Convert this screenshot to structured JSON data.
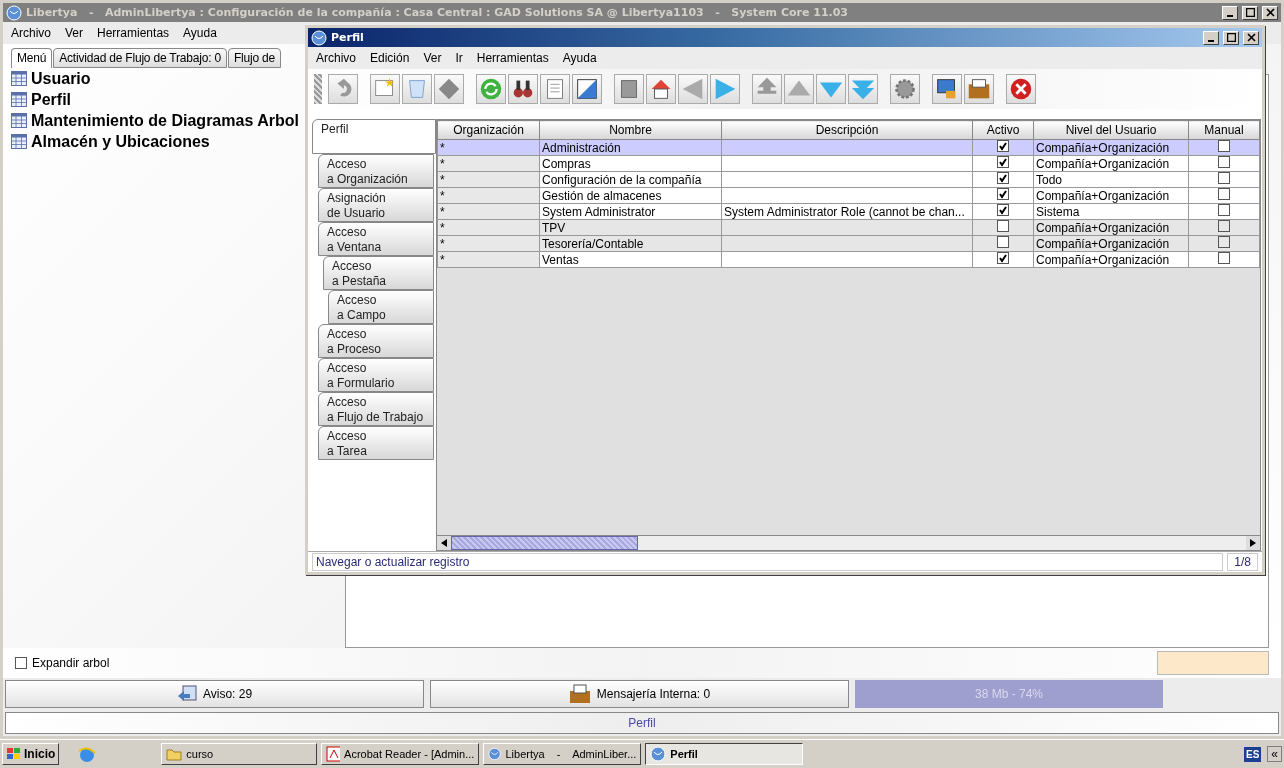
{
  "main_window": {
    "title": "Libertya   -   AdminLibertya : Configuración de la compañía : Casa Central : GAD Solutions SA @ Libertya1103   -   System Core 11.03",
    "menu": [
      "Archivo",
      "Ver",
      "Herramientas",
      "Ayuda"
    ],
    "tabs": [
      {
        "label": "Menú",
        "selected": true
      },
      {
        "label": "Actividad de Flujo de Trabajo: 0",
        "selected": false
      },
      {
        "label": "Flujo de",
        "selected": false
      }
    ],
    "tree": [
      {
        "label": "Usuario"
      },
      {
        "label": "Perfil"
      },
      {
        "label": "Mantenimiento de Diagramas Arbol"
      },
      {
        "label": "Almacén y Ubicaciones"
      }
    ],
    "expand_tree": {
      "label": "Expandir arbol",
      "checked": false
    },
    "buttons": [
      {
        "kind": "alert",
        "label": "Aviso: 29"
      },
      {
        "kind": "mail",
        "label": "Mensajería Interna: 0"
      }
    ],
    "memory": "38 Mb - 74%",
    "status": "Perfil"
  },
  "perfil_window": {
    "title": "Perfil",
    "menu": [
      "Archivo",
      "Edición",
      "Ver",
      "Ir",
      "Herramientas",
      "Ayuda"
    ],
    "side_tabs": [
      {
        "label": "Perfil",
        "selected": true
      },
      {
        "label": "Acceso\na Organización",
        "selected": false
      },
      {
        "label": "Asignación\nde Usuario",
        "selected": false
      },
      {
        "label": "Acceso\na Ventana",
        "selected": false,
        "children": [
          {
            "label": "Acceso\na Pestaña",
            "selected": false,
            "children": [
              {
                "label": "Acceso\na Campo",
                "selected": false
              }
            ]
          }
        ]
      },
      {
        "label": "Acceso\na Proceso",
        "selected": false
      },
      {
        "label": "Acceso\na Formulario",
        "selected": false
      },
      {
        "label": "Acceso\na Flujo de Trabajo",
        "selected": false
      },
      {
        "label": "Acceso\na Tarea",
        "selected": false
      }
    ],
    "table": {
      "columns": [
        "Organización",
        "Nombre",
        "Descripción",
        "Activo",
        "Nivel del Usuario",
        "Manual"
      ],
      "rows": [
        {
          "org": "*",
          "name": "Administración",
          "description": "",
          "active": true,
          "level": "Compañía+Organización",
          "manual": false,
          "selected": true
        },
        {
          "org": "*",
          "name": "Compras",
          "description": "",
          "active": true,
          "level": "Compañía+Organización",
          "manual": false,
          "selected": false
        },
        {
          "org": "*",
          "name": "Configuración de la compañía",
          "description": "",
          "active": true,
          "level": "Todo",
          "manual": false,
          "selected": false
        },
        {
          "org": "*",
          "name": "Gestión de almacenes",
          "description": "",
          "active": true,
          "level": "Compañía+Organización",
          "manual": false,
          "selected": false
        },
        {
          "org": "*",
          "name": "System Administrator",
          "description": "System Administrator Role (cannot be chan...",
          "active": true,
          "level": "Sistema",
          "manual": false,
          "selected": false
        },
        {
          "org": "*",
          "name": "TPV",
          "description": "",
          "active": false,
          "level": "Compañía+Organización",
          "manual": false,
          "selected": false
        },
        {
          "org": "*",
          "name": "Tesorería/Contable",
          "description": "",
          "active": false,
          "level": "Compañía+Organización",
          "manual": false,
          "selected": false
        },
        {
          "org": "*",
          "name": "Ventas",
          "description": "",
          "active": true,
          "level": "Compañía+Organización",
          "manual": false,
          "selected": false
        }
      ]
    },
    "status": "Navegar o actualizar registro",
    "record": "1/8"
  },
  "taskbar": {
    "start": "Inicio",
    "tasks": [
      {
        "kind": "folder",
        "label": "curso",
        "selected": false
      },
      {
        "kind": "pdf",
        "label": "Acrobat Reader - [Admin...",
        "selected": false
      },
      {
        "kind": "app",
        "label": "Libertya    -    AdminLiber...",
        "selected": false
      },
      {
        "kind": "app",
        "label": "Perfil",
        "selected": true
      }
    ],
    "language": "ES",
    "expand": "«"
  }
}
